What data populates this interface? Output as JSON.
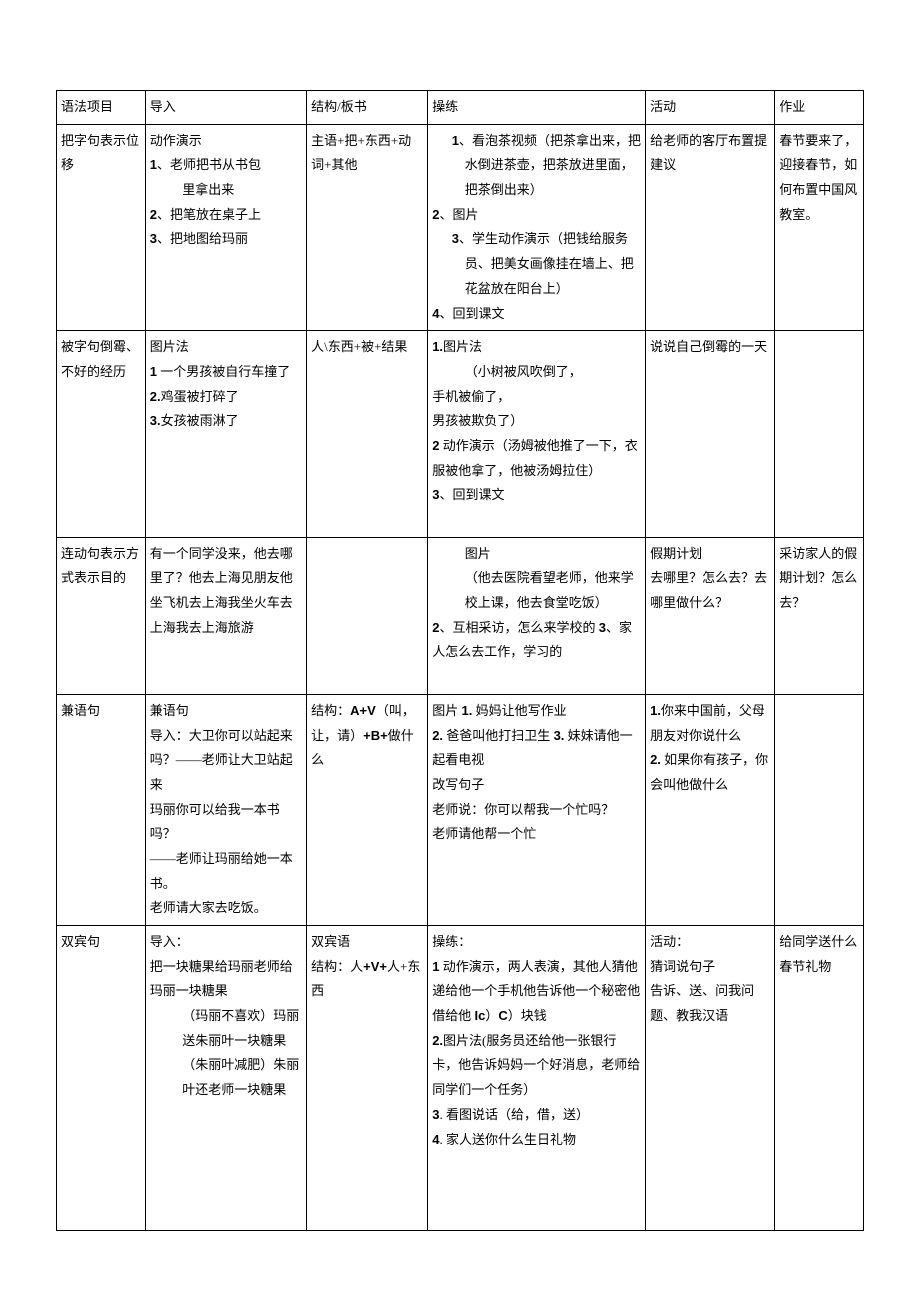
{
  "headers": {
    "col1": "语法项目",
    "col2": "导入",
    "col3": "结构/板书",
    "col4": "操练",
    "col5": "活动",
    "col6": "作业"
  },
  "rows": [
    {
      "topic": "把字句表示位移",
      "intro_title": "动作演示",
      "intro_1": "1、老师把书从书包",
      "intro_1b": "里拿出来",
      "intro_2": "2、把笔放在桌子上",
      "intro_3": "3、把地图给玛丽",
      "struct": "主语+把+东西+动词+其他",
      "drill_1": "1、看泡茶视频（把茶拿出来，把水倒进茶壶，把茶放进里面，把茶倒出来）",
      "drill_2": "2、图片",
      "drill_3": "3、学生动作演示（把钱给服务员、把美女画像挂在墙上、把花盆放在阳台上）",
      "drill_4": "4、回到课文",
      "activity": "给老师的客厅布置提建议",
      "hw": "春节要来了，迎接春节，如何布置中国风教室。"
    },
    {
      "topic": "被字句倒霉、不好的经历",
      "intro_title": "图片法",
      "intro_1": "1 一个男孩被自行车撞了",
      "intro_2": "2.鸡蛋被打碎了",
      "intro_3": "3.女孩被雨淋了",
      "struct": "人\\东西+被+结果",
      "drill_1_title": "1.图片法",
      "drill_1a": "（小树被风吹倒了，",
      "drill_1b": "手机被偷了，",
      "drill_1c": "男孩被欺负了）",
      "drill_2": "2 动作演示（汤姆被他推了一下，衣服被他拿了，他被汤姆拉住）",
      "drill_3": "3、回到课文",
      "activity": "说说自己倒霉的一天",
      "hw": ""
    },
    {
      "topic": "连动句表示方式表示目的",
      "intro": "有一个同学没来，他去哪里了？他去上海见朋友他坐飞机去上海我坐火车去上海我去上海旅游",
      "struct": "",
      "drill_1_title": "图片",
      "drill_1": "（他去医院看望老师，他来学校上课，他去食堂吃饭）",
      "drill_2": "2、互相采访，怎么来学校的 3、家人怎么去工作，学习的",
      "activity": "假期计划\n去哪里？怎么去？去哪里做什么？",
      "hw": "采访家人的假期计划？怎么去？"
    },
    {
      "topic": "兼语句",
      "intro_title": "兼语句",
      "intro_1": "导入：大卫你可以站起来吗？——老师让大卫站起来",
      "intro_2": "玛丽你可以给我一本书吗？",
      "intro_3": "——老师让玛丽给她一本书。",
      "intro_4": "老师请大家去吃饭。",
      "struct": "结构：A+V（叫，让，请）+B+做什么",
      "drill_1": "图片 1. 妈妈让他写作业",
      "drill_2": "2. 爸爸叫他打扫卫生 3. 妹妹请他一起看电视",
      "drill_3": "改写句子",
      "drill_4": "老师说：你可以帮我一个忙吗？",
      "drill_5": "老师请他帮一个忙",
      "activity_1": "1.你来中国前，父母朋友对你说什么",
      "activity_2": "2. 如果你有孩子，你会叫他做什么",
      "hw": ""
    },
    {
      "topic": "双宾句",
      "intro_title": "导入：",
      "intro_1": "把一块糖果给玛丽老师给玛丽一块糖果",
      "intro_2": "（玛丽不喜欢）玛丽送朱丽叶一块糖果（朱丽叶减肥）朱丽叶还老师一块糖果",
      "struct_title": "双宾语",
      "struct": "结构：人+V+人+东西",
      "drill_title": "操练：",
      "drill_1": "1 动作演示，两人表演，其他人猜他递给他一个手机他告诉他一个秘密他借给他 Ic）C）块钱",
      "drill_2": "2.图片法(服务员还给他一张银行卡，他告诉妈妈一个好消息，老师给同学们一个任务）",
      "drill_3": "3. 看图说话（给，借，送）",
      "drill_4": "4. 家人送你什么生日礼物",
      "activity_title": "活动：",
      "activity_1": "猜词说句子",
      "activity_2": "告诉、送、问我问题、教我汉语",
      "hw": "给同学送什么春节礼物"
    }
  ]
}
